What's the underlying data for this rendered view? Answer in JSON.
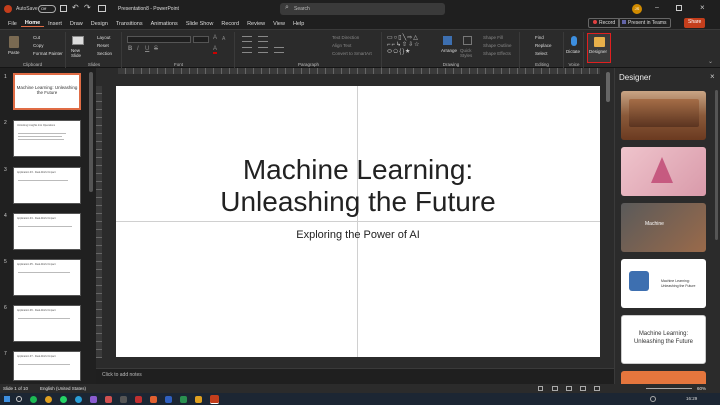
{
  "titlebar": {
    "autosave_label": "AutoSave",
    "toggle_state": "Off",
    "filename": "Presentation8 - PowerPoint",
    "search_placeholder": "Search",
    "user_initials": "JS"
  },
  "menu": {
    "tabs": [
      "File",
      "Home",
      "Insert",
      "Draw",
      "Design",
      "Transitions",
      "Animations",
      "Slide Show",
      "Record",
      "Review",
      "View",
      "Help"
    ],
    "active": "Home",
    "record_button": "Record",
    "present_teams": "Present in Teams",
    "share": "Share"
  },
  "ribbon": {
    "clipboard": {
      "paste": "Paste",
      "cut": "Cut",
      "copy": "Copy",
      "format_painter": "Format Painter",
      "label": "Clipboard"
    },
    "slides": {
      "new_slide": "New Slide",
      "layout": "Layout",
      "reset": "Reset",
      "section": "Section",
      "label": "Slides"
    },
    "font": {
      "label": "Font"
    },
    "paragraph": {
      "text_direction": "Text Direction",
      "align_text": "Align Text",
      "smartart": "Convert to SmartArt",
      "label": "Paragraph"
    },
    "drawing": {
      "arrange": "Arrange",
      "quick_styles": "Quick Styles",
      "shape_fill": "Shape Fill",
      "shape_outline": "Shape Outline",
      "shape_effects": "Shape Effects",
      "label": "Drawing"
    },
    "editing": {
      "find": "Find",
      "replace": "Replace",
      "select": "Select",
      "label": "Editing"
    },
    "voice": {
      "dictate": "Dictate",
      "label": "Voice"
    },
    "designer": {
      "label": "Designer"
    }
  },
  "thumbnails": [
    {
      "num": "1",
      "title": "Machine Learning: Unleashing the Future",
      "selected": true
    },
    {
      "num": "2",
      "title": "Unlocking Insights Into Operations",
      "selected": false
    },
    {
      "num": "3",
      "title": "Application #3 - Real-World Impact",
      "selected": false
    },
    {
      "num": "4",
      "title": "Application #4 - Real-World Impact",
      "selected": false
    },
    {
      "num": "5",
      "title": "Application #5 - Real-World Impact",
      "selected": false
    },
    {
      "num": "6",
      "title": "Application #6 - Real-World Impact",
      "selected": false
    },
    {
      "num": "7",
      "title": "Application #7 - Real-World Impact",
      "selected": false
    }
  ],
  "slide": {
    "title_line1": "Machine Learning:",
    "title_line2": "Unleashing the Future",
    "subtitle": "Exploring the Power of AI"
  },
  "notes": {
    "placeholder": "Click to add notes"
  },
  "designer_pane": {
    "title": "Designer",
    "thumb4_line1": "Machine Learning:",
    "thumb4_line2": "Unleashing the Future",
    "thumb5_line1": "Machine Learning:",
    "thumb5_line2": "Unleashing the Future",
    "thumb3_text": "Machine"
  },
  "status": {
    "slide_info": "Slide 1 of 10",
    "language": "English (United States)",
    "zoom": "60%"
  },
  "taskbar": {
    "time": "16:29"
  }
}
